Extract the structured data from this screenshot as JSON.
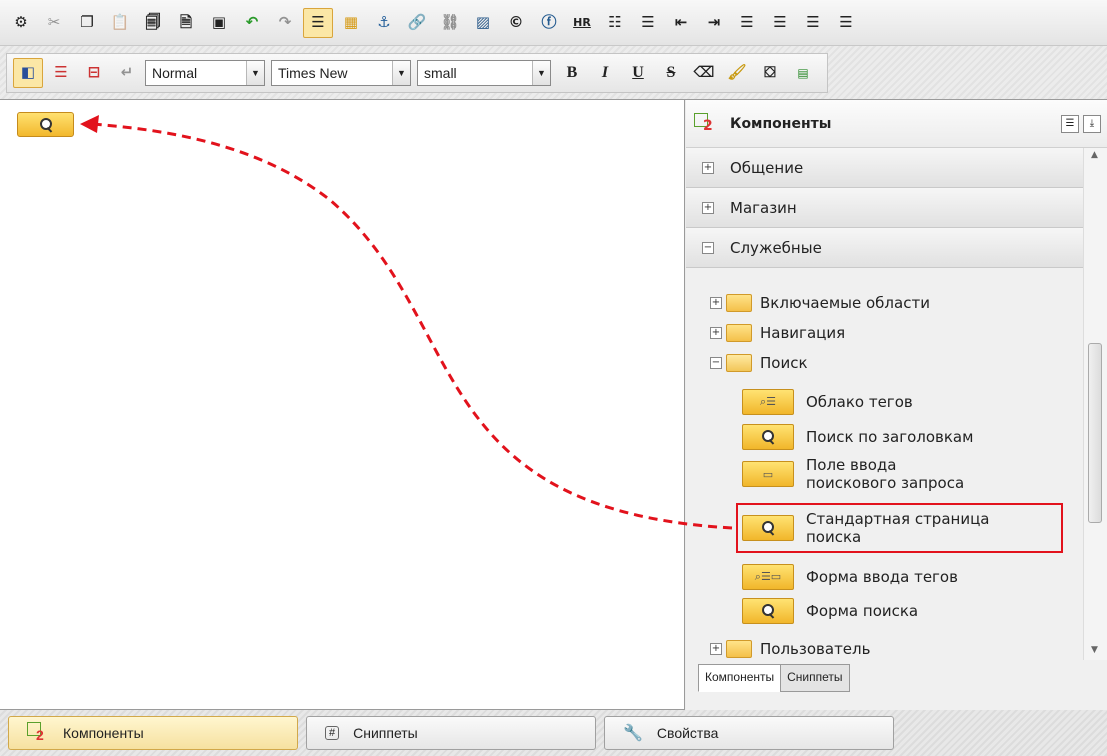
{
  "toolbar2": {
    "style_select": "Normal",
    "font_select": "Times New",
    "size_select": "small",
    "format_buttons": [
      "B",
      "I",
      "U",
      "S"
    ]
  },
  "toolbar1": {
    "hr_label": "HR"
  },
  "panel": {
    "title": "Компоненты",
    "groups": [
      "Общение",
      "Магазин",
      "Служебные"
    ],
    "folders": {
      "included": "Включаемые области",
      "navigation": "Навигация",
      "search": "Поиск",
      "user": "Пользователь"
    },
    "components": [
      "Облако тегов",
      "Поиск по заголовкам",
      "Поле ввода поискового запроса",
      "Стандартная страница поиска",
      "Форма ввода тегов",
      "Форма поиска"
    ],
    "tabs": [
      "Компоненты",
      "Сниппеты"
    ]
  },
  "bottom_tabs": [
    "Компоненты",
    "Сниппеты",
    "Свойства"
  ],
  "colors": {
    "highlight": "#e2121c",
    "arrow": "#e2121c",
    "component_fill": "#f4c040"
  },
  "icons": [
    "gear-icon",
    "cut-icon",
    "copy-icon",
    "paste-icon",
    "undo-icon",
    "redo-icon",
    "anchor-icon",
    "image-icon",
    "copyright-icon",
    "flash-icon",
    "list-icon",
    "align-icon",
    "search-icon",
    "folder-icon",
    "wrench-icon"
  ]
}
